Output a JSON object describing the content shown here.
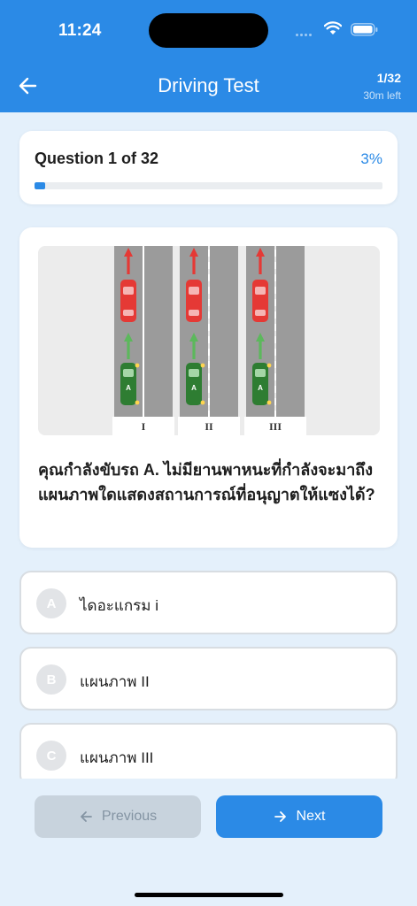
{
  "status_bar": {
    "time": "11:24"
  },
  "header": {
    "title": "Driving Test",
    "question_count": "1/32",
    "time_left": "30m left"
  },
  "progress": {
    "label": "Question 1 of 32",
    "percent_text": "3%",
    "fraction": 0.03
  },
  "question": {
    "text": "คุณกำลังขับรถ A. ไม่มียานพาหนะที่กำลังจะมาถึง แผนภาพใดแสดงสถานการณ์ที่อนุญาตให้แซงได้?",
    "figure": {
      "car_label": "A",
      "panel_labels": [
        "I",
        "II",
        "III"
      ]
    }
  },
  "options": [
    {
      "letter": "A",
      "label": "ไดอะแกรม i"
    },
    {
      "letter": "B",
      "label": "แผนภาพ II"
    },
    {
      "letter": "C",
      "label": "แผนภาพ III"
    }
  ],
  "nav": {
    "previous_label": "Previous",
    "next_label": "Next"
  },
  "colors": {
    "accent": "#2b8ae6",
    "background": "#e4f0fb",
    "red_car": "#e53935",
    "green_car": "#2e7d32"
  }
}
